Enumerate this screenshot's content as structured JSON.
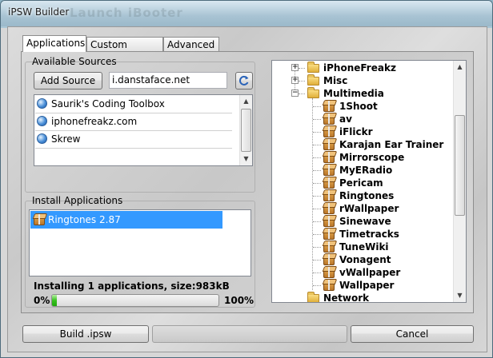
{
  "window": {
    "title": "iPSW Builder",
    "ghost_title": "Launch iBooter"
  },
  "tabs": [
    {
      "label": "Applications",
      "active": true
    },
    {
      "label": "Custom Images",
      "active": false
    },
    {
      "label": "Advanced",
      "active": false
    }
  ],
  "sources": {
    "group_label": "Available Sources",
    "add_button": "Add Source",
    "input_value": "i.danstaface.net",
    "refresh_icon": "refresh-icon",
    "items": [
      {
        "label": "Saurik's Coding Toolbox",
        "icon": "globe-icon"
      },
      {
        "label": "iphonefreakz.com",
        "icon": "globe-icon"
      },
      {
        "label": "Skrew",
        "icon": "globe-icon"
      }
    ]
  },
  "install": {
    "group_label": "Install Applications",
    "items": [
      {
        "label": "Ringtones 2.87",
        "selected": true,
        "icon": "package-icon"
      }
    ],
    "status": "Installing 1 applications, size:983kB",
    "progress_min_label": "0%",
    "progress_max_label": "100%",
    "progress_fraction": 0.01
  },
  "tree": {
    "folders": [
      {
        "label": "iPhoneFreakz",
        "expanded": false
      },
      {
        "label": "Misc",
        "expanded": false
      },
      {
        "label": "Multimedia",
        "expanded": true
      }
    ],
    "apps": [
      "1Shoot",
      "av",
      "iFlickr",
      "Karajan Ear Trainer",
      "Mirrorscope",
      "MyERadio",
      "Pericam",
      "Ringtones",
      "rWallpaper",
      "Sinewave",
      "Timetracks",
      "TuneWiki",
      "Vonagent",
      "vWallpaper",
      "Wallpaper"
    ],
    "partial_next": "Network"
  },
  "footer": {
    "build_button": "Build .ipsw",
    "cancel_button": "Cancel"
  }
}
